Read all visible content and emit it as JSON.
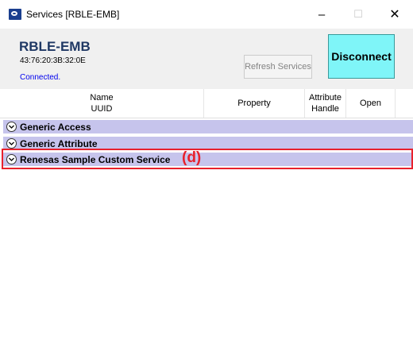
{
  "window": {
    "title": "Services [RBLE-EMB]",
    "minimize_glyph": "–",
    "maximize_glyph": "☐",
    "close_glyph": "✕",
    "icon": "app-icon"
  },
  "header": {
    "device_name": "RBLE-EMB",
    "device_address": "43:76:20:3B:32:0E",
    "status": "Connected.",
    "refresh_label": "Refresh Services",
    "disconnect_label": "Disconnect"
  },
  "columns": {
    "name": "Name",
    "uuid": "UUID",
    "property": "Property",
    "attribute": "Attribute",
    "handle": "Handle",
    "open": "Open"
  },
  "services": [
    {
      "label": "Generic Access"
    },
    {
      "label": "Generic Attribute"
    },
    {
      "label": "Renesas Sample Custom Service"
    }
  ],
  "annotation": {
    "label": "(d)",
    "color": "#e8212c"
  },
  "colors": {
    "row_background": "#c6c4ec",
    "disconnect_background": "#7ff5f8",
    "device_name": "#1f3864"
  }
}
